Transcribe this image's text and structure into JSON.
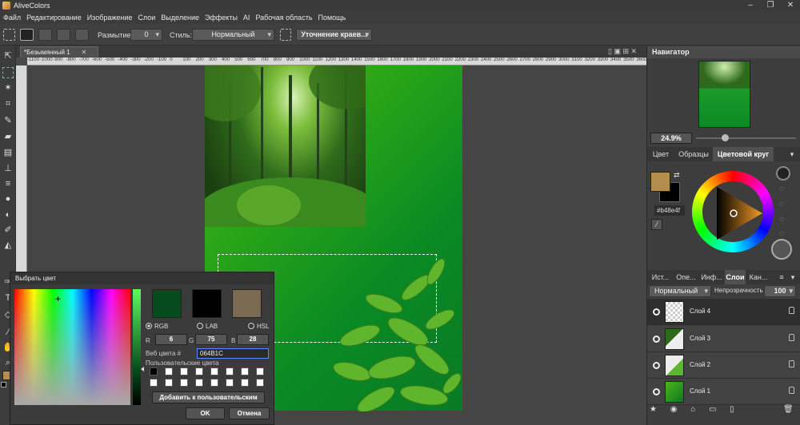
{
  "app": {
    "title": "AliveColors"
  },
  "menu": [
    "Файл",
    "Редактирование",
    "Изображение",
    "Слои",
    "Выделение",
    "Эффекты",
    "AI",
    "Рабочая область",
    "Помощь"
  ],
  "toolbar": {
    "blur_label": "Размытие",
    "blur_value": "0",
    "style_label": "Стиль:",
    "style_value": "Нормальный",
    "refine_button": "Уточнение краев..."
  },
  "document": {
    "tab_title": "*Безымянный 1",
    "ruler_ticks": [
      "-1100",
      "-1000",
      "-900",
      "-800",
      "-700",
      "-600",
      "-500",
      "-400",
      "-300",
      "-200",
      "-100",
      "0",
      "100",
      "200",
      "300",
      "400",
      "500",
      "600",
      "700",
      "800",
      "900",
      "1000",
      "1100",
      "1200",
      "1300",
      "1400",
      "1500",
      "1600",
      "1700",
      "1800",
      "1900",
      "2000",
      "2100",
      "2200",
      "2300",
      "2400",
      "2500",
      "2600",
      "2700",
      "2800",
      "2900",
      "3000",
      "3100",
      "3200",
      "3300",
      "3400",
      "3500",
      "3600"
    ]
  },
  "navigator": {
    "title": "Навигатор",
    "zoom": "24.9%"
  },
  "color_panel": {
    "tabs": [
      "Цвет",
      "Образцы",
      "Цветовой круг"
    ],
    "active_tab": "Цветовой круг",
    "hex": "#b48e4f",
    "fg_color": "#b48e4f",
    "bg_color": "#000000"
  },
  "layers_panel": {
    "tabs": [
      "Ист...",
      "Опе...",
      "Инф...",
      "Слои",
      "Кан..."
    ],
    "active_tab": "Слои",
    "blend_mode": "Нормальный",
    "opacity_label": "Непрозрачность",
    "opacity_value": "100",
    "layers": [
      {
        "name": "Слой 4",
        "selected": true
      },
      {
        "name": "Слой 3",
        "selected": false
      },
      {
        "name": "Слой 2",
        "selected": false
      },
      {
        "name": "Слой 1",
        "selected": false
      }
    ]
  },
  "color_dialog": {
    "title": "Выбрать цвет",
    "models": [
      "RGB",
      "LAB",
      "HSL"
    ],
    "selected_model": "RGB",
    "r_label": "R",
    "g_label": "G",
    "b_label": "B",
    "r": "6",
    "g": "75",
    "b": "28",
    "web_label": "Веб цвета #",
    "web_value": "064B1C",
    "custom_label": "Пользовательские цвета",
    "add_button": "Добавить к пользовательским",
    "ok_button": "OK",
    "cancel_button": "Отмена",
    "swatches": [
      "#064b1c",
      "#000000",
      "#7a6a52"
    ]
  }
}
